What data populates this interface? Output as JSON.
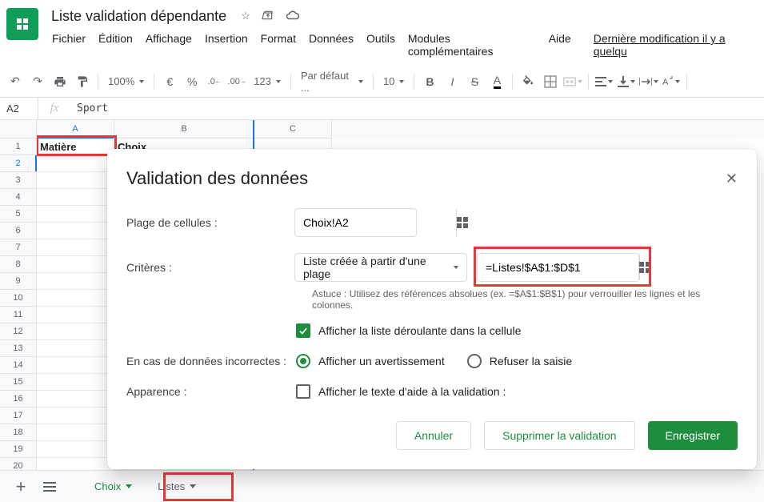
{
  "doc": {
    "title": "Liste validation dépendante"
  },
  "menu": {
    "file": "Fichier",
    "edit": "Édition",
    "view": "Affichage",
    "insert": "Insertion",
    "format": "Format",
    "data": "Données",
    "tools": "Outils",
    "addons": "Modules complémentaires",
    "help": "Aide",
    "last_edit": "Dernière modification il y a quelqu"
  },
  "toolbar": {
    "zoom": "100%",
    "font": "Par défaut ...",
    "font_size": "10",
    "format_menu": "123"
  },
  "name_box": "A2",
  "formula": "Sport",
  "columns": [
    "A",
    "B",
    "C"
  ],
  "rows_count": 20,
  "data_cells": {
    "A1": "Matière",
    "B1": "Choix"
  },
  "dialog": {
    "title": "Validation des données",
    "label_range": "Plage de cellules :",
    "range_value": "Choix!A2",
    "label_criteria": "Critères :",
    "criteria_type": "Liste créée à partir d'une plage",
    "criteria_range": "=Listes!$A$1:$D$1",
    "hint": "Astuce : Utilisez des références absolues (ex. =$A$1:$B$1) pour verrouiller les lignes et les colonnes.",
    "show_dropdown": "Afficher la liste déroulante dans la cellule",
    "label_invalid": "En cas de données incorrectes :",
    "opt_warn": "Afficher un avertissement",
    "opt_reject": "Refuser la saisie",
    "label_appearance": "Apparence :",
    "show_help": "Afficher le texte d'aide à la validation :",
    "btn_cancel": "Annuler",
    "btn_delete": "Supprimer la validation",
    "btn_save": "Enregistrer"
  },
  "tabs": {
    "active": "Choix",
    "inactive": "Listes"
  }
}
